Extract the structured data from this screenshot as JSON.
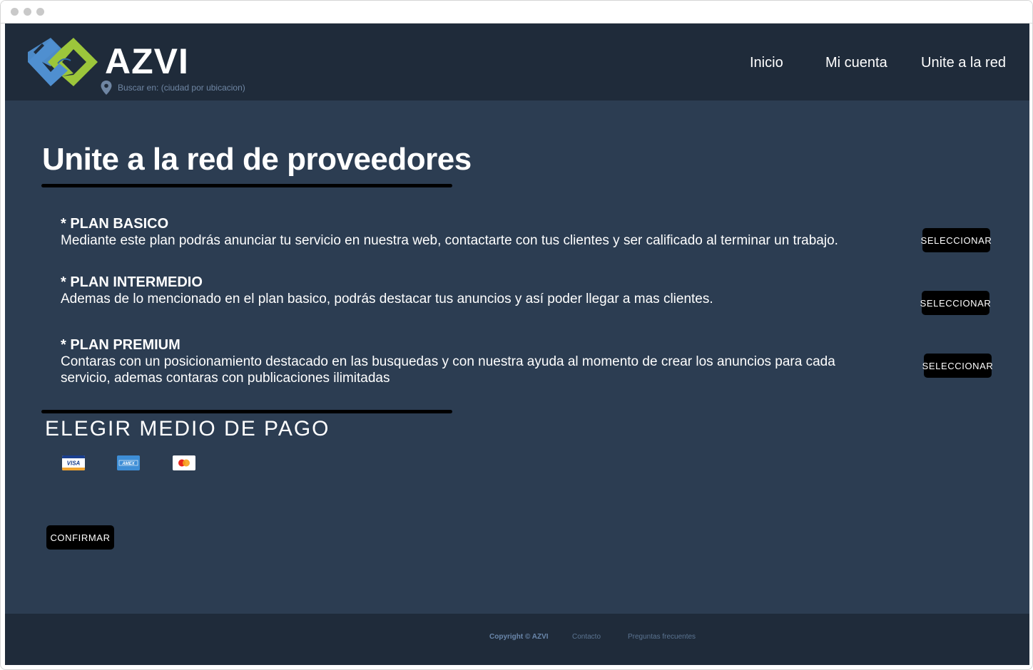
{
  "header": {
    "brand": "AZVI",
    "location_text": "Buscar en: (ciudad por ubicacion)",
    "nav": [
      "Inicio",
      "Mi cuenta",
      "Unite a la red"
    ]
  },
  "main": {
    "title": "Unite a la red de proveedores",
    "plans": [
      {
        "name": "* PLAN BASICO",
        "description": "Mediante este plan podrás anunciar tu servicio en nuestra web, contactarte con tus clientes y ser calificado al terminar un trabajo.",
        "button": "SELECCIONAR"
      },
      {
        "name": "* PLAN INTERMEDIO",
        "description": "Ademas de lo mencionado en el plan basico, podrás destacar tus anuncios y así poder llegar a mas clientes.",
        "button": "SELECCIONAR"
      },
      {
        "name": "* PLAN PREMIUM",
        "description": "Contaras con un posicionamiento destacado en las busquedas y con nuestra ayuda al momento de crear los anuncios para cada servicio, ademas contaras con publicaciones ilimitadas",
        "button": "SELECCIONAR"
      }
    ],
    "payment": {
      "title": "ELEGIR MEDIO DE PAGO",
      "cards": [
        {
          "icon": "visa-card-icon",
          "label": "VISA"
        },
        {
          "icon": "amex-card-icon",
          "label": "AMEX"
        },
        {
          "icon": "mastercard-card-icon",
          "label": ""
        }
      ]
    },
    "confirm_label": "CONFIRMAR"
  },
  "footer": {
    "copyright": "Copyright © AZVI",
    "links": [
      "Contacto",
      "Preguntas frecuentes"
    ]
  },
  "colors": {
    "page_bg": "#2c3d52",
    "header_bg": "#1f2b3a",
    "logo_blue": "#4f8fd0",
    "logo_green": "#9cc63b"
  }
}
